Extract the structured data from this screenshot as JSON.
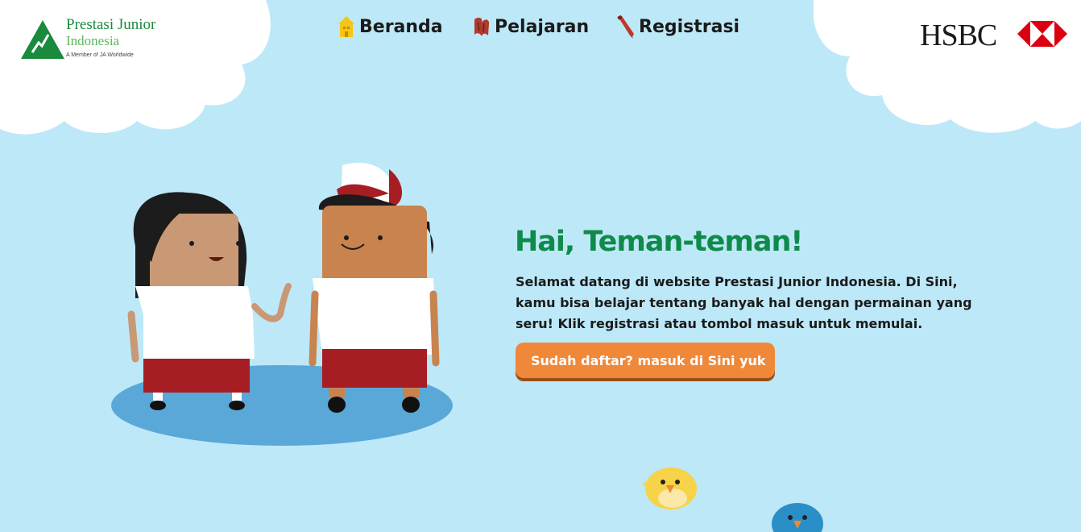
{
  "logo": {
    "line1": "Prestasi Junior",
    "line2": "Indonesia",
    "line3": "A Member of JA Worldwide"
  },
  "nav": [
    {
      "label": "Beranda",
      "icon": "house-icon"
    },
    {
      "label": "Pelajaran",
      "icon": "book-icon"
    },
    {
      "label": "Registrasi",
      "icon": "pencil-icon"
    }
  ],
  "sponsor": {
    "name": "HSBC"
  },
  "hero": {
    "title": "Hai, Teman-teman!",
    "body": "Selamat datang di website Prestasi Junior Indonesia. Di Sini, kamu bisa belajar tentang banyak hal dengan permainan yang seru! Klik registrasi atau tombol masuk untuk memulai.",
    "cta": "Sudah daftar? masuk di Sini yuk"
  },
  "colors": {
    "background": "#bde8f8",
    "title_green": "#0f8a4a",
    "cta_orange": "#f0883a",
    "hsbc_red": "#db0011"
  }
}
